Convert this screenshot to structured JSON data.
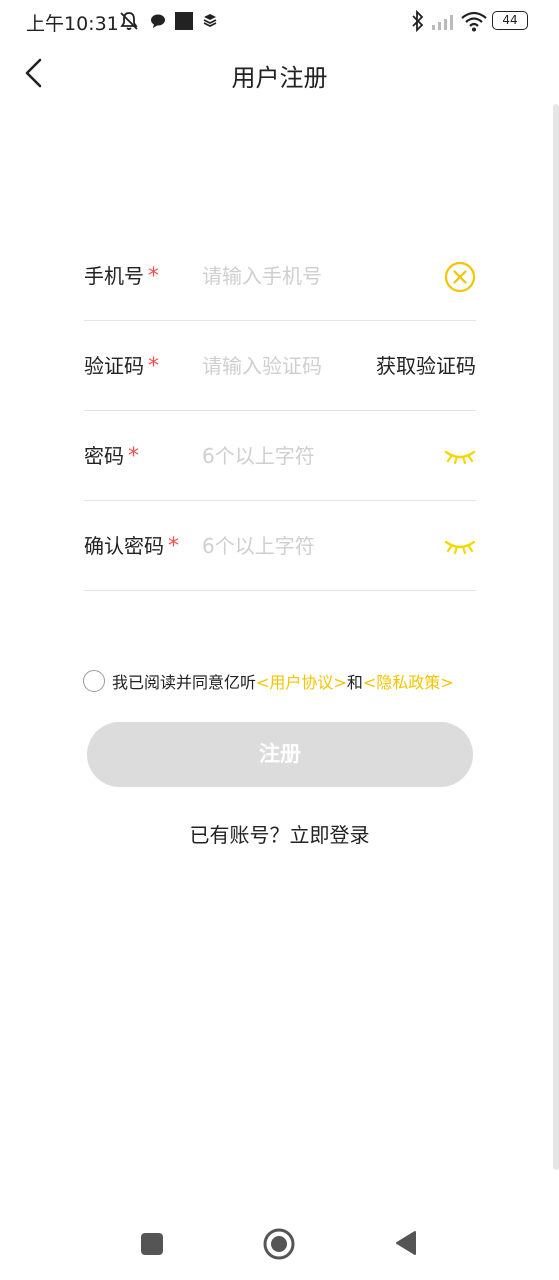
{
  "status_bar": {
    "time": "上午10:31",
    "battery": "44",
    "icons": [
      "mute-icon",
      "chat-icon",
      "square-icon",
      "layers-icon",
      "bluetooth-icon",
      "signal-icon",
      "wifi-icon",
      "battery-icon"
    ]
  },
  "header": {
    "title": "用户注册"
  },
  "form": {
    "phone": {
      "label": "手机号",
      "required_mark": "*",
      "placeholder": "请输入手机号"
    },
    "code": {
      "label": "验证码",
      "required_mark": "*",
      "placeholder": "请输入验证码",
      "button_label": "获取验证码"
    },
    "password": {
      "label": "密码",
      "required_mark": "*",
      "placeholder": "6个以上字符"
    },
    "confirm_password": {
      "label": "确认密码",
      "required_mark": "*",
      "placeholder": "6个以上字符"
    }
  },
  "agreement": {
    "text": "我已阅读并同意亿听",
    "user_agreement": "<用户协议>",
    "conjunction": "和",
    "privacy_policy": "<隐私政策>"
  },
  "actions": {
    "register_label": "注册",
    "login_link": "已有账号？立即登录"
  },
  "colors": {
    "accent": "#f5c400",
    "required": "#ff4d4f",
    "disabled_button": "#dcdcdc",
    "placeholder": "#cfcfcf"
  }
}
